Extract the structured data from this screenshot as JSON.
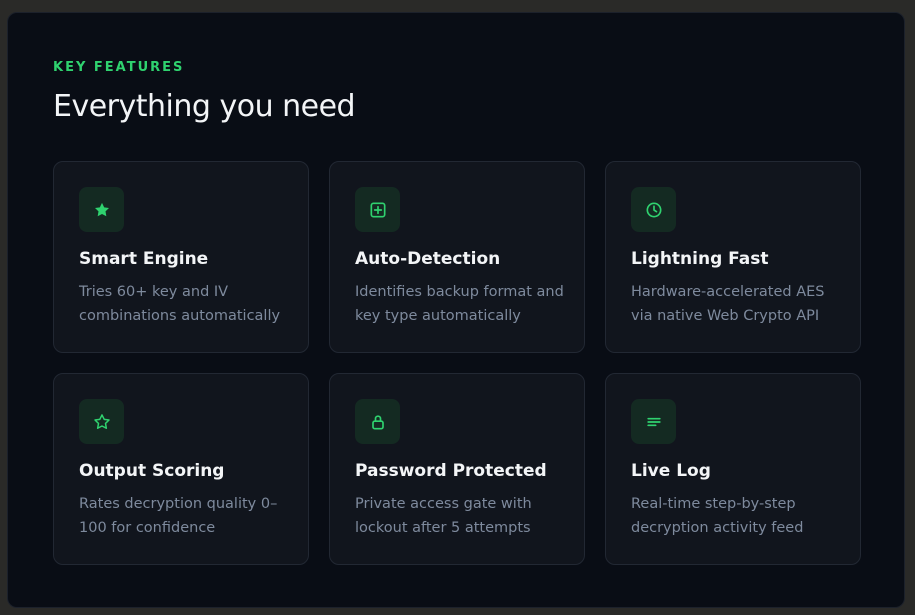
{
  "section": {
    "eyebrow": "KEY FEATURES",
    "title": "Everything you need"
  },
  "accent_color": "#2fd26f",
  "features": [
    {
      "icon": "star-filled-icon",
      "title": "Smart Engine",
      "description": "Tries 60+ key and IV combinations automatically"
    },
    {
      "icon": "square-plus-icon",
      "title": "Auto-Detection",
      "description": "Identifies backup format and key type automatically"
    },
    {
      "icon": "clock-icon",
      "title": "Lightning Fast",
      "description": "Hardware-accelerated AES via native Web Crypto API"
    },
    {
      "icon": "star-outline-icon",
      "title": "Output Scoring",
      "description": "Rates decryption quality 0–100 for confidence"
    },
    {
      "icon": "lock-icon",
      "title": "Password Protected",
      "description": "Private access gate with lockout after 5 attempts"
    },
    {
      "icon": "list-lines-icon",
      "title": "Live Log",
      "description": "Real-time step-by-step decryption activity feed"
    }
  ]
}
